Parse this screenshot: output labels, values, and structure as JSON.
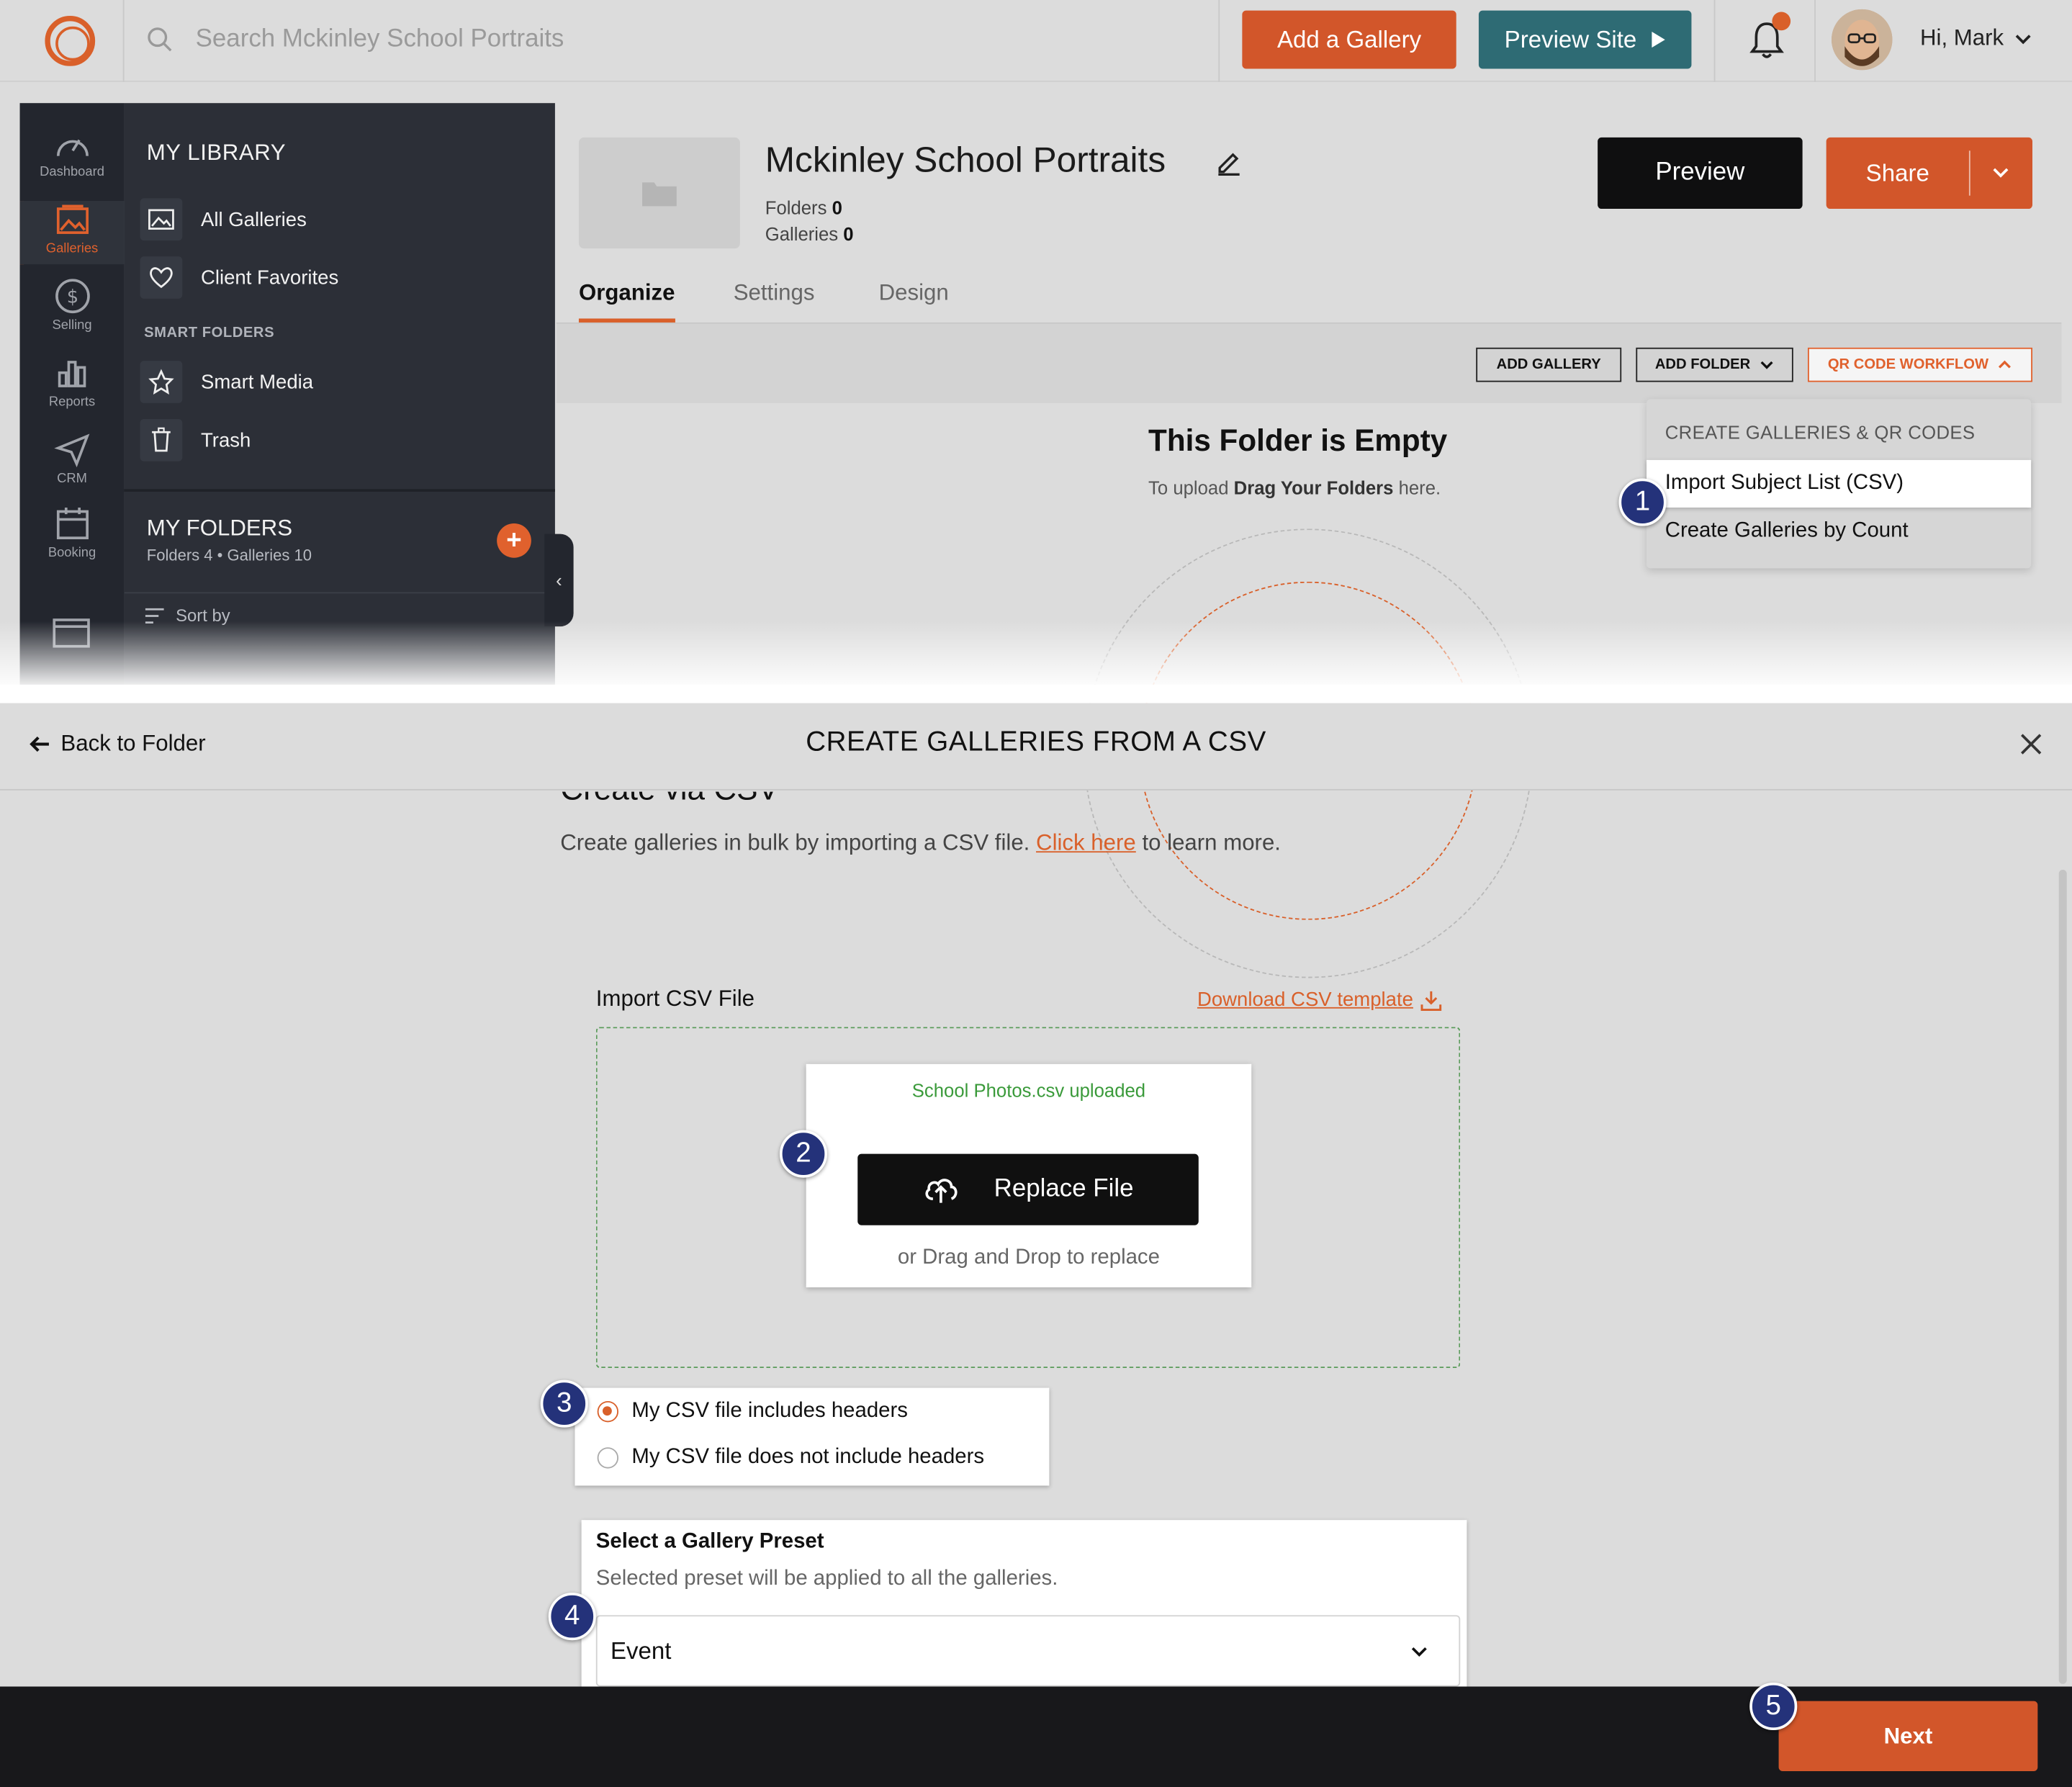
{
  "topbar": {
    "search_placeholder": "Search Mckinley School Portraits",
    "add_gallery": "Add a Gallery",
    "preview_site": "Preview Site",
    "greeting": "Hi, Mark"
  },
  "rail": {
    "items": [
      {
        "label": "Dashboard",
        "icon": "gauge-icon"
      },
      {
        "label": "Galleries",
        "icon": "image-icon"
      },
      {
        "label": "Selling",
        "icon": "dollar-icon"
      },
      {
        "label": "Reports",
        "icon": "bar-chart-icon"
      },
      {
        "label": "CRM",
        "icon": "send-icon"
      },
      {
        "label": "Booking",
        "icon": "calendar-icon"
      }
    ]
  },
  "library": {
    "title": "MY LIBRARY",
    "all_galleries": "All Galleries",
    "client_favorites": "Client Favorites",
    "smart_folders": "SMART FOLDERS",
    "smart_media": "Smart Media",
    "trash": "Trash",
    "my_folders": "MY FOLDERS",
    "my_folders_meta": "Folders 4 • Galleries 10",
    "sort_by": "Sort by"
  },
  "folder": {
    "title": "Mckinley School Portraits",
    "folders_label": "Folders",
    "folders_count": "0",
    "galleries_label": "Galleries",
    "galleries_count": "0",
    "preview": "Preview",
    "share": "Share"
  },
  "tabs": [
    "Organize",
    "Settings",
    "Design"
  ],
  "toolbar": {
    "add_gallery": "ADD GALLERY",
    "add_folder": "ADD FOLDER",
    "qr_workflow": "QR CODE WORKFLOW"
  },
  "empty": {
    "title": "This Folder is Empty",
    "sub_prefix": "To upload ",
    "sub_bold": "Drag Your Folders",
    "sub_suffix": " here."
  },
  "qr_menu": {
    "heading": "CREATE GALLERIES & QR CODES",
    "items": [
      "Import Subject List (CSV)",
      "Create Galleries by Count"
    ]
  },
  "modal": {
    "back": "Back to Folder",
    "title": "CREATE GALLERIES FROM A CSV",
    "heading": "Create via CSV",
    "desc_prefix": "Create galleries in bulk by importing a CSV file. ",
    "desc_link": "Click here",
    "desc_suffix": " to learn more.",
    "import_label": "Import CSV File",
    "download_template": "Download CSV template",
    "uploaded_msg": "School Photos.csv uploaded",
    "replace_button": "Replace File",
    "drag_hint": "or Drag and Drop to replace",
    "radio_options": [
      {
        "label": "My CSV file includes headers",
        "checked": true
      },
      {
        "label": "My CSV file does not include headers",
        "checked": false
      }
    ],
    "preset_title": "Select a Gallery Preset",
    "preset_sub": "Selected preset will be applied to all the galleries.",
    "preset_value": "Event",
    "next": "Next"
  },
  "markers": [
    "1",
    "2",
    "3",
    "4",
    "5"
  ],
  "colors": {
    "accent": "#d2562a",
    "teal": "#2e6b74",
    "marker": "#24327a",
    "success": "#3a9a3a"
  }
}
